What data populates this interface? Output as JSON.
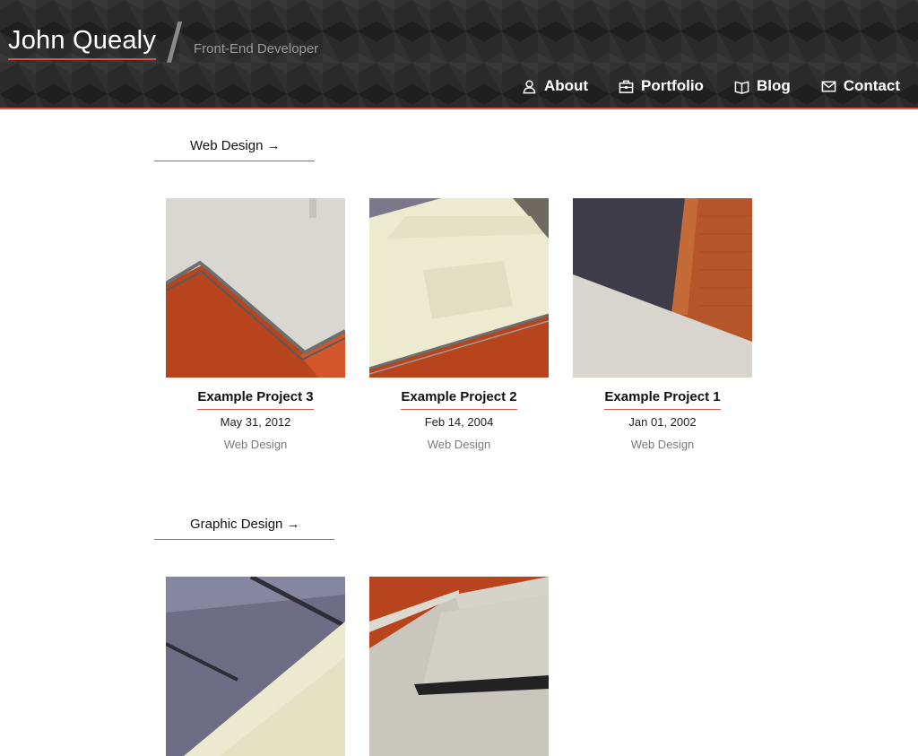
{
  "header": {
    "site_title": "John Quealy",
    "separator": "/",
    "tagline": "Front-End Developer",
    "accent_color": "#d9534a",
    "nav": [
      {
        "label": "About",
        "icon": "person-icon"
      },
      {
        "label": "Portfolio",
        "icon": "briefcase-icon"
      },
      {
        "label": "Blog",
        "icon": "book-icon"
      },
      {
        "label": "Contact",
        "icon": "envelope-icon"
      }
    ]
  },
  "sections": [
    {
      "heading": "Web Design →",
      "projects": [
        {
          "title": "Example Project 3",
          "date": "May 31, 2012",
          "category": "Web Design"
        },
        {
          "title": "Example Project 2",
          "date": "Feb 14, 2004",
          "category": "Web Design"
        },
        {
          "title": "Example Project 1",
          "date": "Jan 01, 2002",
          "category": "Web Design"
        }
      ]
    },
    {
      "heading": "Graphic Design →",
      "projects": []
    }
  ]
}
